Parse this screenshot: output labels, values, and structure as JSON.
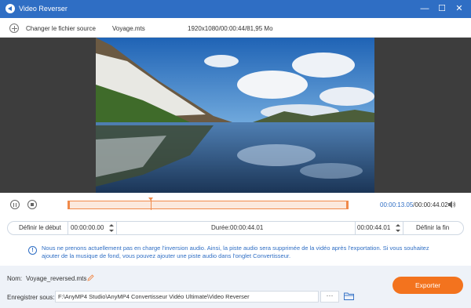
{
  "window": {
    "title": "Video Reverser",
    "minimize_glyph": "—",
    "maximize_glyph": "☐",
    "close_glyph": "✕"
  },
  "infobar": {
    "add_source_label": "Changer le fichier source",
    "file_name": "Voyage.mts",
    "file_info": "1920x1080/00:00:44/81,95 Mo"
  },
  "timeline": {
    "current_time": "00:00:13.05",
    "total_time": "/00:00:44.02",
    "playhead_fraction": 0.296
  },
  "trim": {
    "set_start_label": "Définir le début",
    "start_time": "00:00:00.00",
    "duration_label": "Durée:00:00:44.01",
    "end_time": "00:00:44.01",
    "set_end_label": "Définir la fin"
  },
  "notice": {
    "text": "Nous ne prenons actuellement pas en charge l'inversion audio. Ainsi, la piste audio sera supprimée de la vidéo après l'exportation. Si vous souhaitez ajouter de la musique de fond, vous pouvez ajouter une piste audio dans l'onglet Convertisseur."
  },
  "output": {
    "name_label": "Nom:",
    "name_value": "Voyage_reversed.mts",
    "save_label": "Enregistrer sous:",
    "save_path": "F:\\AnyMP4 Studio\\AnyMP4 Convertisseur Vidéo Ultimate\\Video Reverser",
    "browse_label": "···",
    "export_label": "Exporter"
  },
  "colors": {
    "accent": "#2f6ec4",
    "export": "#f3731e",
    "trim": "#f08a4b"
  }
}
